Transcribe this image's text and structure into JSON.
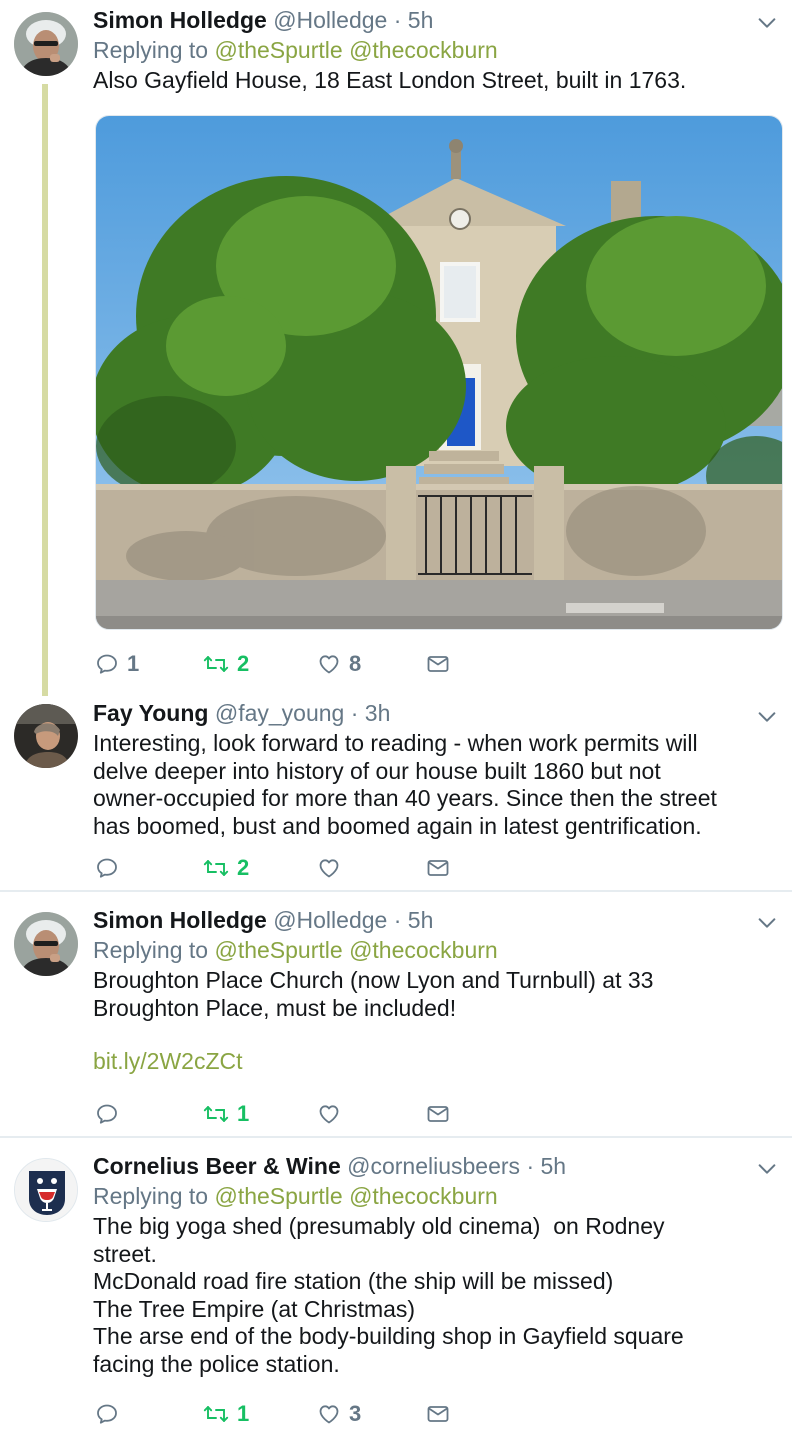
{
  "tweets": [
    {
      "name": "Simon Holledge",
      "handle": "@Holledge",
      "time": "5h",
      "replying_prefix": "Replying to",
      "mentions": [
        "@theSpurtle",
        "@thecockburn"
      ],
      "text_lines": [
        "Also Gayfield House, 18 East London Street, built in 1763."
      ],
      "counts": {
        "reply": "1",
        "retweet": "2",
        "like": "8"
      }
    },
    {
      "name": "Fay Young",
      "handle": "@fay_young",
      "time": "3h",
      "text_lines": [
        "Interesting, look forward to reading - when work permits will",
        "delve deeper into history of our house built 1860 but not",
        "owner-occupied for more than 40 years. Since then the street",
        "has boomed, bust and boomed again in latest gentrification."
      ],
      "counts": {
        "reply": "",
        "retweet": "2",
        "like": ""
      }
    },
    {
      "name": "Simon Holledge",
      "handle": "@Holledge",
      "time": "5h",
      "replying_prefix": "Replying to",
      "mentions": [
        "@theSpurtle",
        "@thecockburn"
      ],
      "text_lines": [
        "Broughton Place Church (now Lyon and Turnbull) at 33",
        "Broughton Place, must be included!"
      ],
      "link": "bit.ly/2W2cZCt",
      "counts": {
        "reply": "",
        "retweet": "1",
        "like": ""
      }
    },
    {
      "name": "Cornelius Beer & Wine",
      "handle": "@corneliusbeers",
      "time": "5h",
      "replying_prefix": "Replying to",
      "mentions": [
        "@theSpurtle",
        "@thecockburn"
      ],
      "text_lines": [
        "The big yoga shed (presumably old cinema)  on Rodney",
        "street.",
        "McDonald road fire station (the ship will be missed)",
        "The Tree Empire (at Christmas)",
        "The arse end of the body-building shop in Gayfield square",
        "facing the police station."
      ],
      "counts": {
        "reply": "",
        "retweet": "1",
        "like": "3"
      }
    }
  ],
  "colors": {
    "mention": "#8aa543",
    "retweet_active": "#17bf63",
    "muted": "#657786",
    "thread_line": "#d6dba3"
  },
  "icons": [
    "reply-icon",
    "retweet-icon",
    "like-icon",
    "dm-icon",
    "chevron-down-icon"
  ]
}
